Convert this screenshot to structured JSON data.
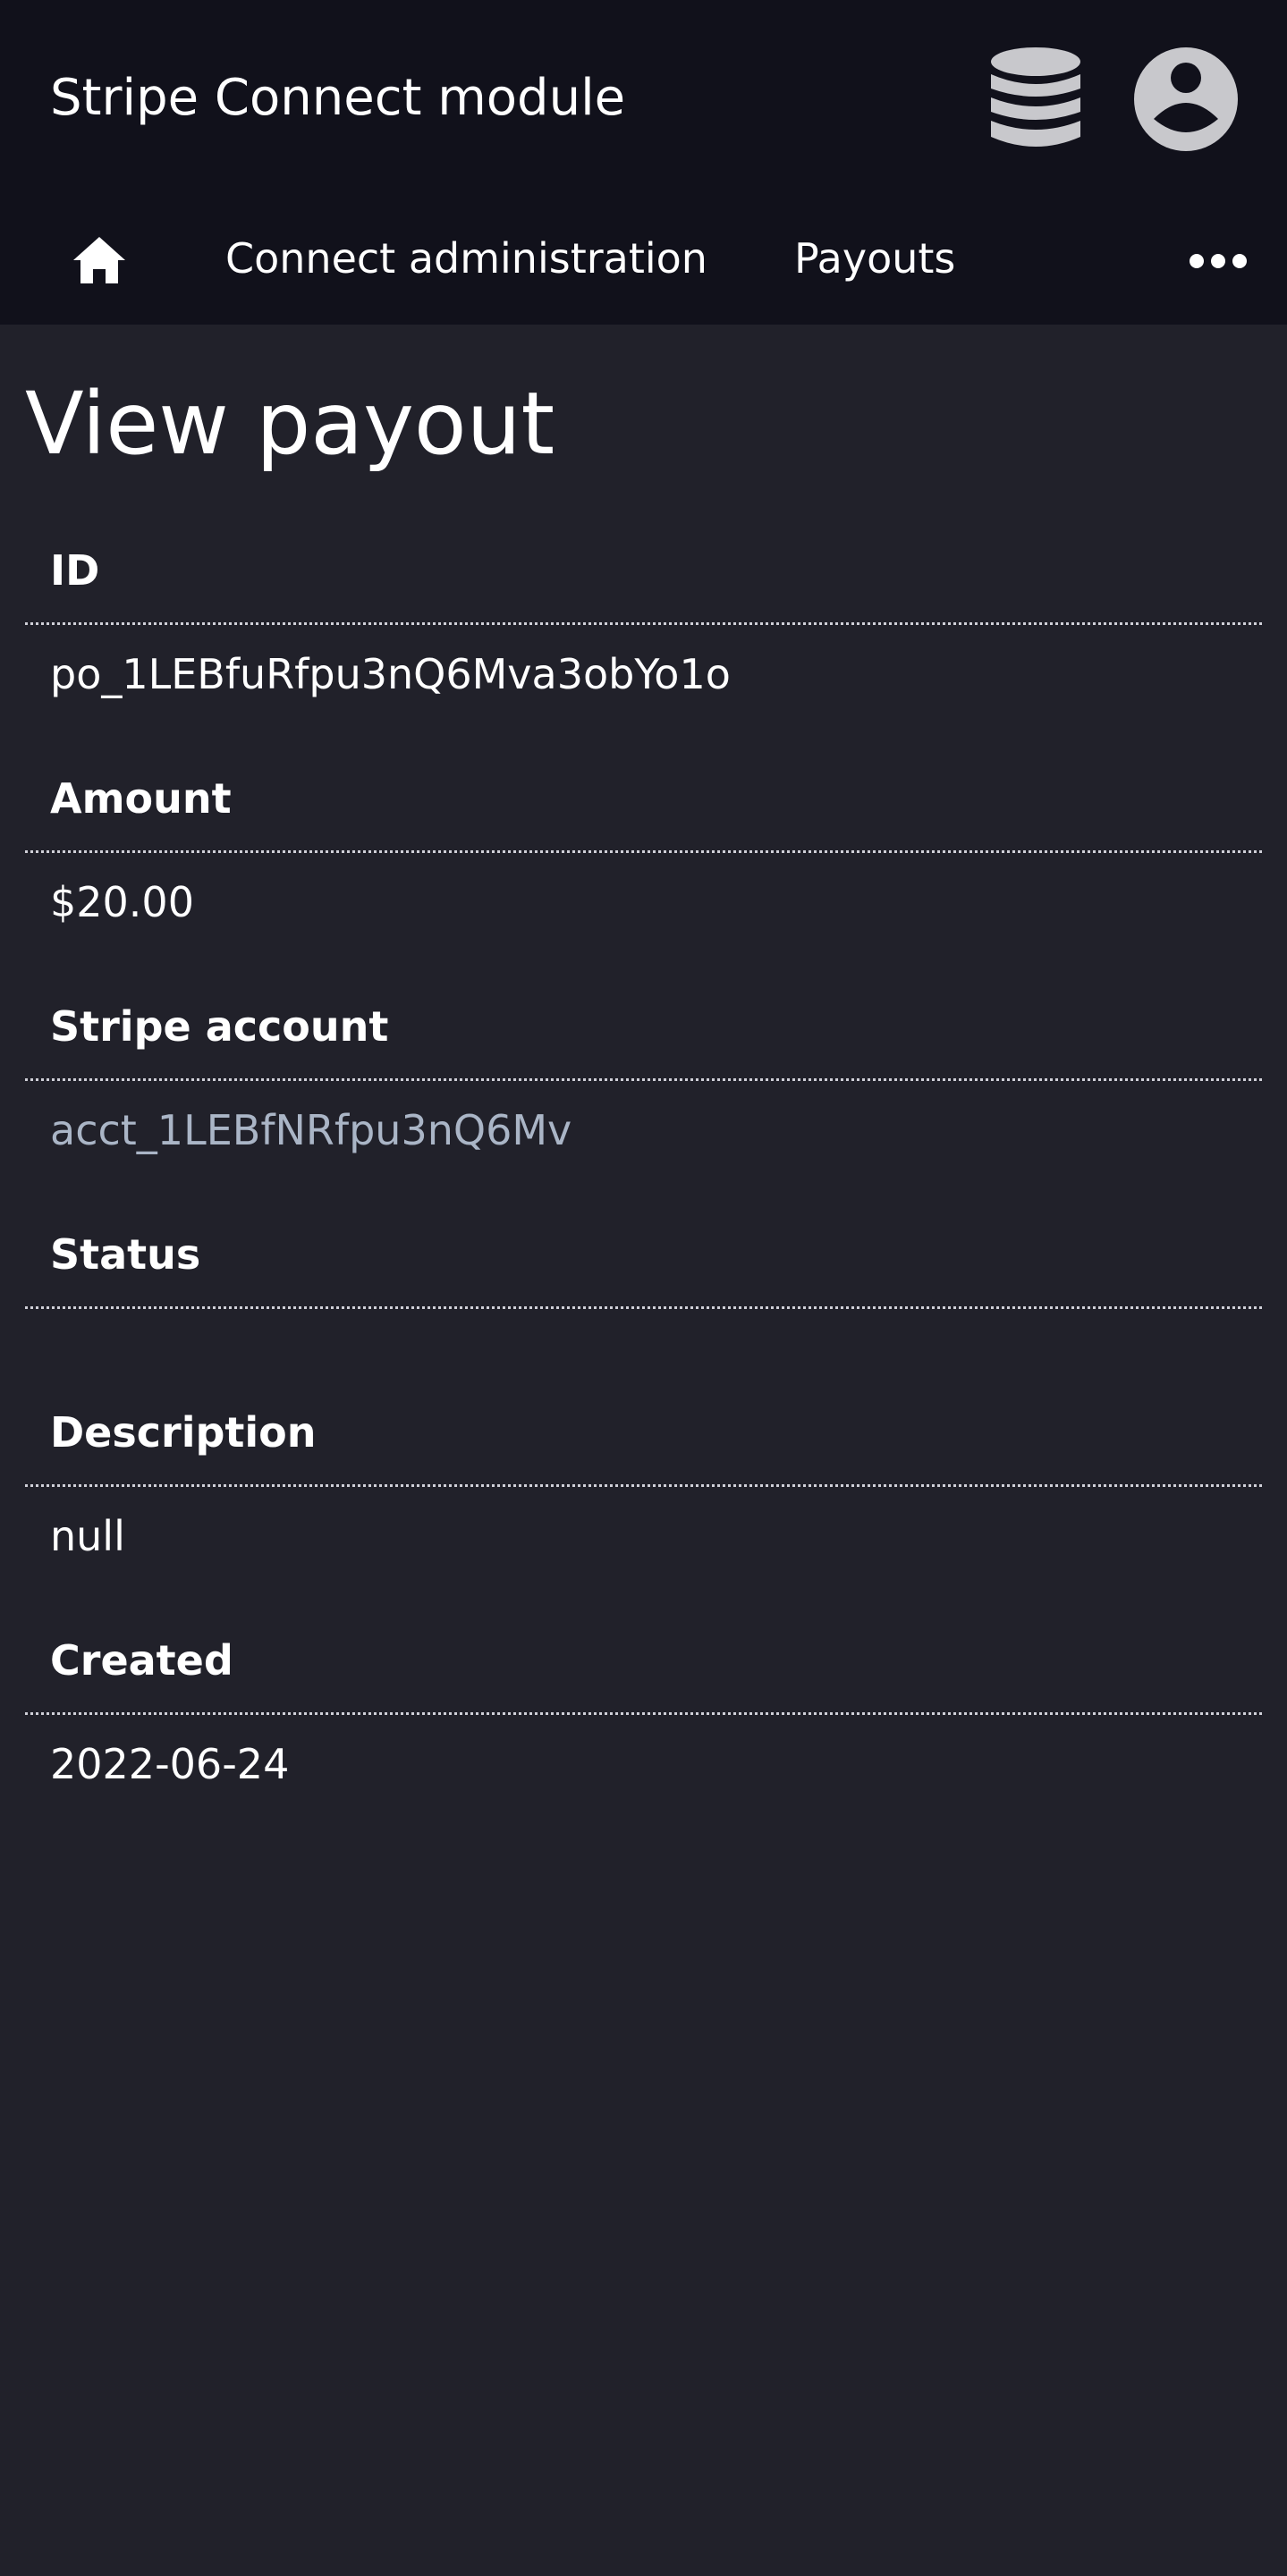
{
  "header": {
    "title": "Stripe Connect module",
    "icons": {
      "database": "database-icon",
      "account": "user-circle-icon"
    }
  },
  "nav": {
    "home_icon": "home-icon",
    "items": [
      {
        "label": "Connect administration"
      },
      {
        "label": "Payouts"
      }
    ],
    "more_icon": "more-horizontal-icon"
  },
  "page": {
    "title": "View payout"
  },
  "fields": {
    "id": {
      "label": "ID",
      "value": "po_1LEBfuRfpu3nQ6Mva3obYo1o"
    },
    "amount": {
      "label": "Amount",
      "value": "$20.00"
    },
    "stripe_account": {
      "label": "Stripe account",
      "value": "acct_1LEBfNRfpu3nQ6Mv"
    },
    "status": {
      "label": "Status",
      "value": ""
    },
    "description": {
      "label": "Description",
      "value": "null"
    },
    "created": {
      "label": "Created",
      "value": "2022-06-24"
    }
  },
  "colors": {
    "background": "#21212a",
    "header_background": "#11111b",
    "link_text": "#aab5c6",
    "icon_gray": "#c8c8cc"
  }
}
